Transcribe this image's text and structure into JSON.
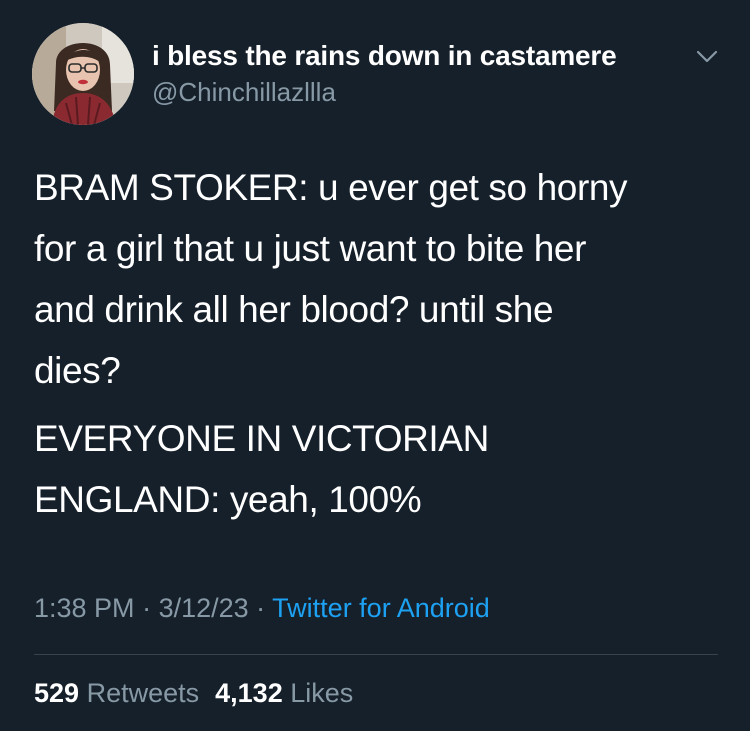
{
  "author": {
    "display_name": "i bless the rains down in castamere",
    "handle": "@Chinchillazllla"
  },
  "tweet": {
    "paragraphs": [
      "BRAM STOKER: u ever get so horny\nfor a girl that u just want to bite her\nand drink all her blood? until she\ndies?",
      "EVERYONE IN VICTORIAN\nENGLAND: yeah, 100%"
    ],
    "time": "1:38 PM",
    "separator": " · ",
    "date": "3/12/23",
    "source": "Twitter for Android"
  },
  "stats": {
    "retweets_count": "529",
    "retweets_label": "Retweets",
    "likes_count": "4,132",
    "likes_label": "Likes"
  },
  "icons": {
    "menu": "chevron-down-icon"
  },
  "colors": {
    "background": "#15202b",
    "primary_text": "#ffffff",
    "secondary_text": "#8899a6",
    "link": "#1da1f2",
    "divider": "#38444d"
  }
}
